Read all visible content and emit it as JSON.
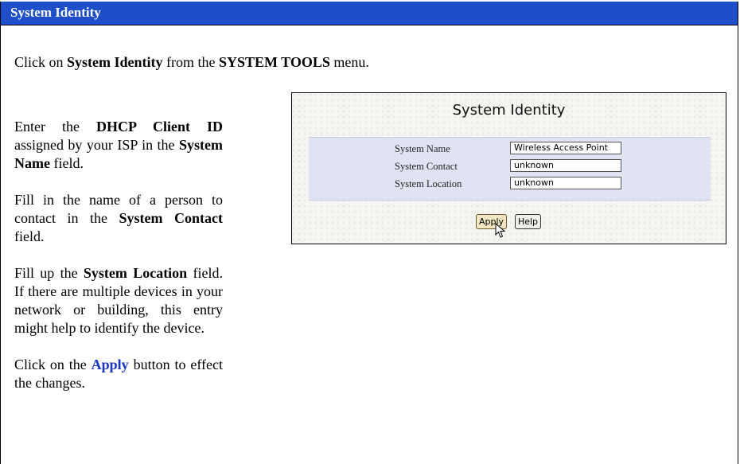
{
  "header": {
    "title": "System Identity"
  },
  "intro": {
    "prefix": "Click on ",
    "item": "System Identity",
    "middle": " from the ",
    "menu": "SYSTEM TOOLS",
    "suffix": " menu."
  },
  "instructions": {
    "p1": {
      "t1": "Enter the ",
      "b1": "DHCP Client ID",
      "t2": " assigned by your ISP in the ",
      "b2": "System Name",
      "t3": " field."
    },
    "p2": {
      "t1": "Fill in the name of a person to contact in the ",
      "b1": "System Contact",
      "t2": " field."
    },
    "p3": {
      "t1": "Fill up the ",
      "b1": "System Location",
      "t2": " field. If there are multiple devices in your network or building, this entry might help to identify the device."
    },
    "p4": {
      "t1": "Click on the ",
      "b1": "Apply",
      "t2": " button to effect the changes."
    }
  },
  "screenshot": {
    "title": "System Identity",
    "fields": [
      {
        "label": "System Name",
        "value": "Wireless Access Point"
      },
      {
        "label": "System Contact",
        "value": "unknown"
      },
      {
        "label": "System Location",
        "value": "unknown"
      }
    ],
    "apply_label": "Apply",
    "help_label": "Help"
  },
  "colors": {
    "header_bg": "#1f4fc8",
    "link_blue": "#1a35c8",
    "form_bg": "#dfe3f3"
  }
}
